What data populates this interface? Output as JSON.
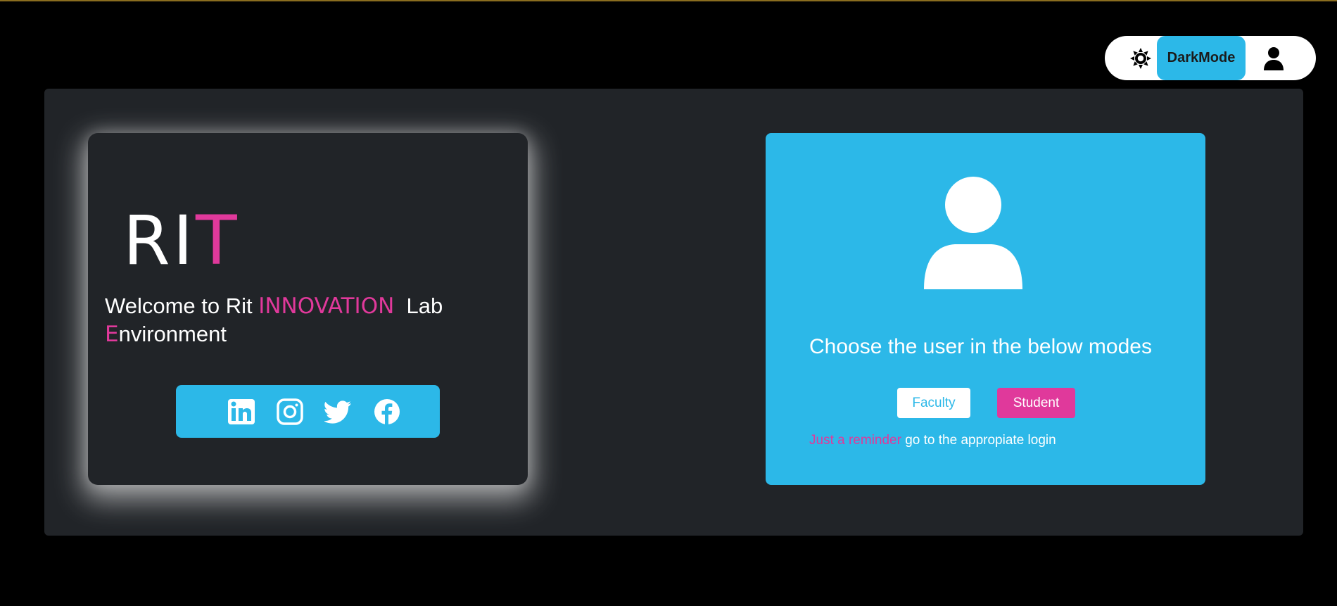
{
  "header": {
    "mode_toggle": {
      "sun_icon": "sun-icon",
      "label": "DarkMode",
      "user_icon": "user-icon"
    }
  },
  "left_card": {
    "logo": {
      "part1": "RI",
      "part2": "T"
    },
    "welcome": {
      "prefix": "Welcome to Rit ",
      "highlight": "INNOVATION",
      "middle": "  Lab",
      "e_letter": "E",
      "suffix": "nvironment"
    },
    "social_icons": [
      "linkedin-icon",
      "instagram-icon",
      "twitter-icon",
      "facebook-icon"
    ]
  },
  "right_card": {
    "heading": "Choose the user in the below modes",
    "faculty_label": "Faculty",
    "student_label": "Student",
    "reminder_highlight": "Just a reminder",
    "reminder_text": " go to the appropiate login"
  },
  "colors": {
    "accent_blue": "#2cb8e8",
    "accent_pink": "#e0399b",
    "panel": "#212428",
    "background": "#000000"
  }
}
